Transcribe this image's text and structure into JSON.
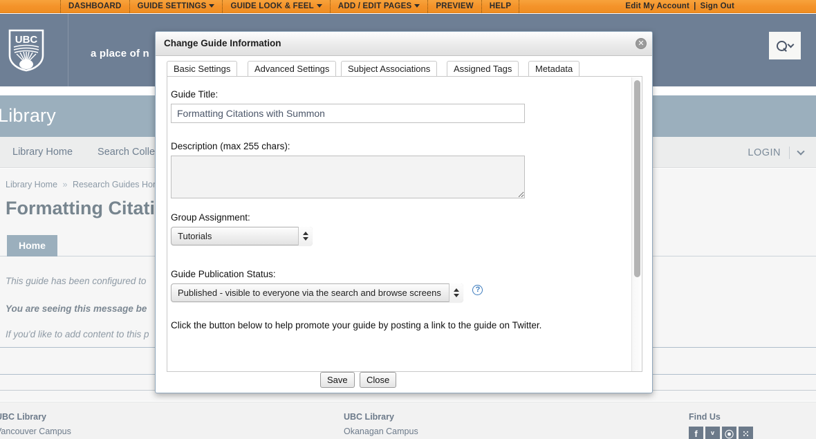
{
  "admin_bar": {
    "items": [
      {
        "label": "DASHBOARD",
        "caret": false
      },
      {
        "label": "GUIDE SETTINGS",
        "caret": true
      },
      {
        "label": "GUIDE LOOK & FEEL",
        "caret": true
      },
      {
        "label": "ADD / EDIT PAGES",
        "caret": true
      },
      {
        "label": "PREVIEW",
        "caret": false
      },
      {
        "label": "HELP",
        "caret": false
      }
    ],
    "edit_account": "Edit My Account",
    "separator": "|",
    "sign_out": "Sign Out",
    "background_color": "#f4932a"
  },
  "masthead": {
    "logo_text": "UBC",
    "tagline": "a place of n",
    "search_icon": "search-icon",
    "background_color": "#6e7f95"
  },
  "library_band": {
    "title": "Library",
    "background_color": "#9bafbd"
  },
  "site_nav": {
    "links": [
      "Library Home",
      "Search Collectio"
    ],
    "login_label": "LOGIN"
  },
  "page": {
    "breadcrumb": [
      {
        "label": "Library Home",
        "sep": "»"
      },
      {
        "label": "Research Guides Home",
        "sep": "»"
      }
    ],
    "heading": "Formatting Citation",
    "tab_label": "Home",
    "line1": "This guide has been configured to",
    "line2": "You are seeing this message be",
    "line3": "If you'd like to add content to this p"
  },
  "footer": {
    "col1_title": "UBC Library",
    "col1_sub": "Vancouver Campus",
    "col2_title": "UBC Library",
    "col2_sub": "Okanagan Campus",
    "col3_title": "Find Us",
    "social": [
      {
        "name": "facebook-icon",
        "glyph": "f"
      },
      {
        "name": "twitter-icon",
        "glyph": "ᵛ"
      },
      {
        "name": "rss-icon",
        "glyph": "⦿"
      },
      {
        "name": "flickr-icon",
        "glyph": "⁙"
      }
    ]
  },
  "modal": {
    "title": "Change Guide Information",
    "close_icon": "close-icon",
    "tabs": [
      {
        "label": "Basic Settings",
        "active": true
      },
      {
        "label": "Advanced Settings",
        "active": false
      },
      {
        "label": "Subject Associations",
        "active": false
      },
      {
        "label": "Assigned Tags",
        "active": false
      },
      {
        "label": "Metadata",
        "active": false
      }
    ],
    "fields": {
      "title_label": "Guide Title:",
      "title_value": "Formatting Citations with Summon",
      "title_placeholder": "",
      "description_label": "Description (max 255 chars):",
      "description_value": "",
      "description_placeholder": "",
      "group_label": "Group Assignment:",
      "group_value": "Tutorials",
      "publication_label": "Guide Publication Status:",
      "publication_value": "Published - visible to everyone via the search and browse screens",
      "help_icon": "help-icon",
      "help_glyph": "?",
      "promo_text": "Click the button below to help promote your guide by posting a link to the guide on Twitter."
    },
    "buttons": {
      "save": "Save",
      "close": "Close"
    }
  }
}
